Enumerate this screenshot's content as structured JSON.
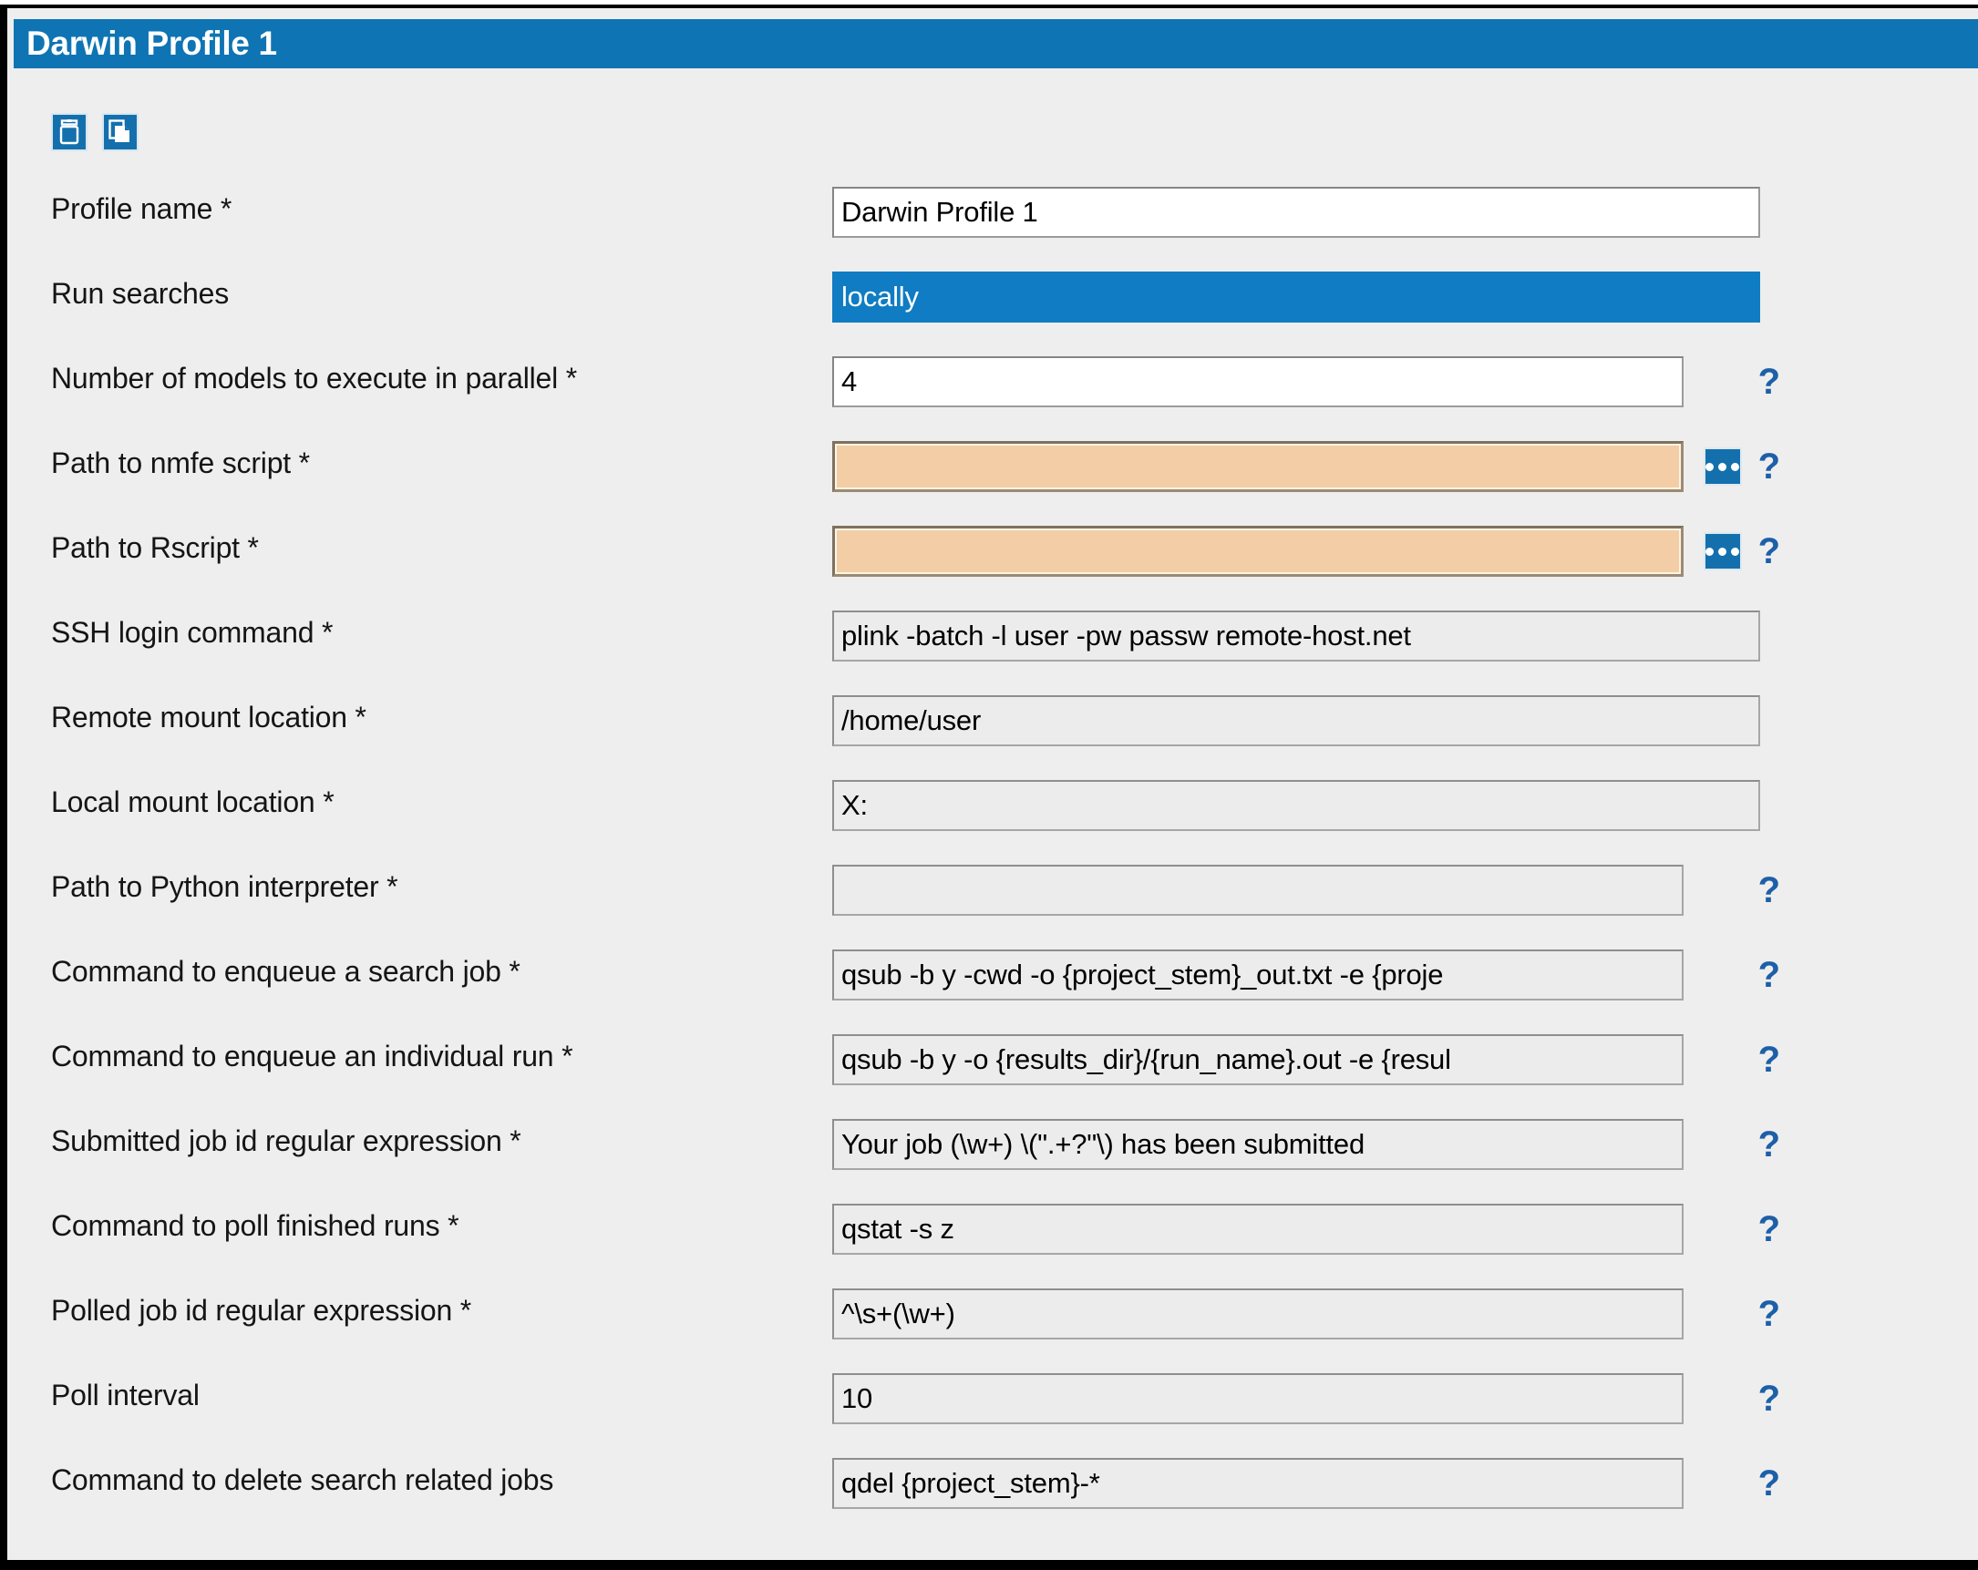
{
  "window": {
    "title": "Darwin Profile 1"
  },
  "toolbar": {
    "items": [
      {
        "name": "delete-profile-button",
        "icon": "trash-icon",
        "label": "Delete"
      },
      {
        "name": "copy-profile-button",
        "icon": "copy-icon",
        "label": "Copy"
      }
    ]
  },
  "help_glyph": "?",
  "form": {
    "rows": [
      {
        "label": "Profile name *",
        "value": "Darwin Profile 1",
        "style": "white",
        "browse": false,
        "help": false,
        "name": "profile-name"
      },
      {
        "label": "Run searches",
        "value": "locally",
        "style": "combo",
        "browse": false,
        "help": false,
        "name": "run-searches"
      },
      {
        "label": "Number of models to execute in parallel *",
        "value": "4",
        "style": "white",
        "browse": false,
        "help": true,
        "name": "models-in-parallel"
      },
      {
        "label": "Path to nmfe script *",
        "value": "",
        "style": "peach",
        "browse": true,
        "help": true,
        "name": "path-to-nmfe-script"
      },
      {
        "label": "Path to Rscript *",
        "value": "",
        "style": "peach",
        "browse": true,
        "help": true,
        "name": "path-to-rscript"
      },
      {
        "label": "SSH login command *",
        "value": "plink -batch -l user -pw passw remote-host.net",
        "style": "grey",
        "browse": false,
        "help": false,
        "name": "ssh-login-command"
      },
      {
        "label": "Remote mount location *",
        "value": "/home/user",
        "style": "grey",
        "browse": false,
        "help": false,
        "name": "remote-mount-location"
      },
      {
        "label": "Local mount location *",
        "value": "X:",
        "style": "grey",
        "browse": false,
        "help": false,
        "name": "local-mount-location"
      },
      {
        "label": "Path to Python interpreter *",
        "value": "",
        "style": "grey",
        "browse": false,
        "help": true,
        "name": "path-to-python-interpreter"
      },
      {
        "label": "Command to enqueue a search job *",
        "value": "qsub -b y -cwd -o {project_stem}_out.txt -e {proje",
        "style": "grey",
        "browse": false,
        "help": true,
        "name": "command-enqueue-search-job"
      },
      {
        "label": "Command to enqueue an individual run *",
        "value": "qsub -b y -o {results_dir}/{run_name}.out -e {resul",
        "style": "grey",
        "browse": false,
        "help": true,
        "name": "command-enqueue-individual-run"
      },
      {
        "label": "Submitted job id regular expression *",
        "value": "Your job (\\w+) \\(\".+?\"\\) has been submitted",
        "style": "grey",
        "browse": false,
        "help": true,
        "name": "submitted-job-id-regex"
      },
      {
        "label": "Command to poll finished runs *",
        "value": "qstat -s z",
        "style": "grey",
        "browse": false,
        "help": true,
        "name": "command-poll-finished-runs"
      },
      {
        "label": "Polled job id regular expression *",
        "value": "^\\s+(\\w+)",
        "style": "grey",
        "browse": false,
        "help": true,
        "name": "polled-job-id-regex"
      },
      {
        "label": "Poll interval",
        "value": "10",
        "style": "grey",
        "browse": false,
        "help": true,
        "name": "poll-interval"
      },
      {
        "label": "Command to delete search related jobs",
        "value": "qdel {project_stem}-*",
        "style": "grey",
        "browse": false,
        "help": true,
        "name": "command-delete-search-jobs"
      }
    ]
  },
  "colors": {
    "title_bar": "#0f74b4",
    "panel_bg": "#eeeeee",
    "required_empty": "#f2cda6",
    "combo_selected": "#0f7cc3",
    "help_icon": "#1d5fa8",
    "icon_button": "#1470ad"
  }
}
